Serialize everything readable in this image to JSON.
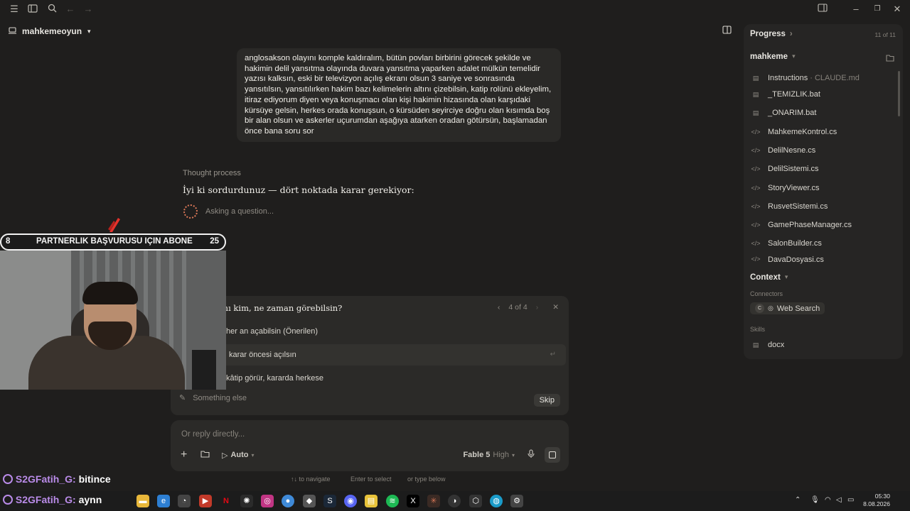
{
  "project": {
    "name": "mahkemeoyun"
  },
  "conversation": {
    "user_message": "anglosakson olayını komple kaldıralım, bütün povları birbirini görecek şekilde ve hakimin delil yansıtma olayında duvara yansıtma yaparken adalet mülkün temelidir yazısı kalksın, eski bir televizyon açılış ekranı olsun 3 saniye ve sonrasında yansıtılsın, yansıtılırken hakim bazı kelimelerin altını çizebilsin,  katip rolünü ekleyelim, itiraz ediyorum diyen veya konuşmacı olan kişi hakimin hizasında olan karşıdaki kürsüye gelsin, herkes orada konuşsun, o kürsüden seyirciye doğru olan kısımda boş bir alan olsun ve askerler uçurumdan aşağıya atarken oradan götürsün, başlamadan önce bana soru sor",
    "thought_label": "Thought process",
    "assistant_text": "İyi ki sordurdunuz — dört noktada karar gerekiyor:",
    "asking_label": "Asking a question..."
  },
  "question": {
    "title": "ını kim, ne zaman görebilsin?",
    "counter": "4 of 4",
    "options": [
      {
        "label": "her an açabilsin (Önerilen)"
      },
      {
        "label": "karar öncesi açılsın"
      },
      {
        "label": "kâtip görür, kararda herkese"
      }
    ],
    "other_placeholder": "Something else",
    "skip_label": "Skip"
  },
  "composer": {
    "placeholder": "Or reply directly...",
    "mode": "Auto",
    "model": "Fable 5",
    "effort": "High"
  },
  "hints": {
    "navigate": "↑↓ to navigate",
    "select": "Enter to select",
    "type": "or type below"
  },
  "right_panel": {
    "progress_label": "Progress",
    "progress_count": "11 of 11",
    "folder": "mahkeme",
    "files": [
      {
        "name": "Instructions",
        "sub": "· CLAUDE.md",
        "icon": "doc-icon"
      },
      {
        "name": "_TEMIZLIK.bat",
        "sub": "",
        "icon": "doc-icon"
      },
      {
        "name": "_ONARIM.bat",
        "sub": "",
        "icon": "doc-icon"
      },
      {
        "name": "MahkemeKontrol.cs",
        "sub": "",
        "icon": "code-icon"
      },
      {
        "name": "DelilNesne.cs",
        "sub": "",
        "icon": "code-icon"
      },
      {
        "name": "DelilSistemi.cs",
        "sub": "",
        "icon": "code-icon"
      },
      {
        "name": "StoryViewer.cs",
        "sub": "",
        "icon": "code-icon"
      },
      {
        "name": "RusvetSistemi.cs",
        "sub": "",
        "icon": "code-icon"
      },
      {
        "name": "GamePhaseManager.cs",
        "sub": "",
        "icon": "code-icon"
      },
      {
        "name": "SalonBuilder.cs",
        "sub": "",
        "icon": "code-icon"
      },
      {
        "name": "DavaDosyasi.cs",
        "sub": "",
        "icon": "code-icon"
      }
    ],
    "context_label": "Context",
    "connectors_label": "Connectors",
    "connector": "Web Search",
    "connector_badge": "C",
    "skills_label": "Skills",
    "skill": "docx"
  },
  "overlay": {
    "left_number": "8",
    "banner": "PARTNERLIK BAŞVURUSU IÇIN ABONE",
    "right_number": "25",
    "chat": [
      {
        "user": "S2GFatih_G:",
        "text": "bitince"
      },
      {
        "user": "S2GFatih_G:",
        "text": "aynn"
      }
    ]
  },
  "taskbar": {
    "time": "05:30",
    "date": "8.08.2026"
  },
  "colors": {
    "accent": "#d97757",
    "background": "#1f1e1d",
    "panel": "#2b2a28",
    "chat_user": "#b98be8"
  }
}
